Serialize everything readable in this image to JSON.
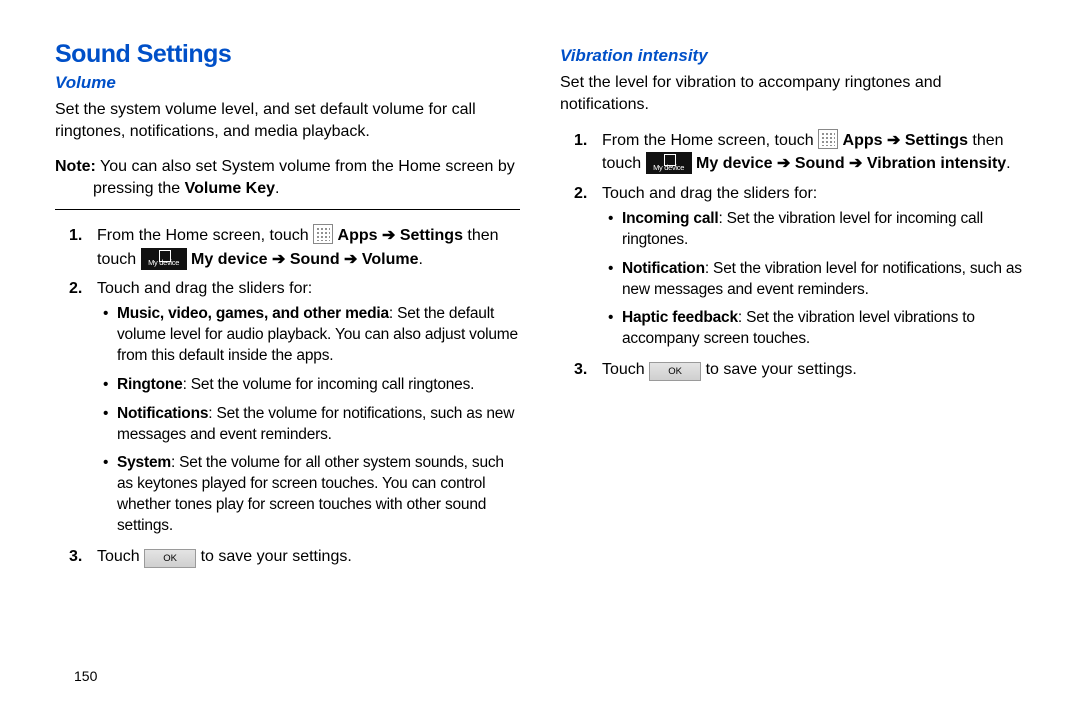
{
  "page_number": "150",
  "heading": "Sound Settings",
  "left": {
    "subheading": "Volume",
    "intro": "Set the system volume level, and set default volume for call ringtones, notifications, and media playback.",
    "note_label": "Note:",
    "note_text": " You can also set System volume from the Home screen by pressing the ",
    "note_bold": "Volume Key",
    "step1_a": "From the Home screen, touch ",
    "step1_b": " Apps ➔ Settings",
    "step1_c": " then touch ",
    "step1_d": " My device ➔ Sound ➔ Volume",
    "step2": "Touch and drag the sliders for:",
    "b1_label": "Music, video, games, and other media",
    "b1_text": ": Set the default volume level for audio playback. You can also adjust volume from this default inside the apps.",
    "b2_label": "Ringtone",
    "b2_text": ": Set the volume for incoming call ringtones.",
    "b3_label": "Notifications",
    "b3_text": ": Set the volume for notifications, such as new messages and event reminders.",
    "b4_label": "System",
    "b4_text": ": Set the volume for all other system sounds, such as keytones played for screen touches. You can control whether tones play for screen touches with other sound settings.",
    "step3_a": "Touch ",
    "step3_b": "OK",
    "step3_c": " to save your settings."
  },
  "right": {
    "subheading": "Vibration intensity",
    "intro": "Set the level for vibration to accompany ringtones and notifications.",
    "step1_a": "From the Home screen, touch ",
    "step1_b": " Apps ➔ Settings",
    "step1_c": " then touch ",
    "step1_d": " My device ➔ Sound ➔ Vibration intensity",
    "step2": "Touch and drag the sliders for:",
    "b1_label": "Incoming call",
    "b1_text": ": Set the vibration level for incoming call ringtones.",
    "b2_label": "Notification",
    "b2_text": ": Set the vibration level for notifications, such as new messages and event reminders.",
    "b3_label": "Haptic feedback",
    "b3_text": ": Set the vibration level vibrations to accompany screen touches.",
    "step3_a": "Touch ",
    "step3_b": "OK",
    "step3_c": " to save your settings."
  }
}
